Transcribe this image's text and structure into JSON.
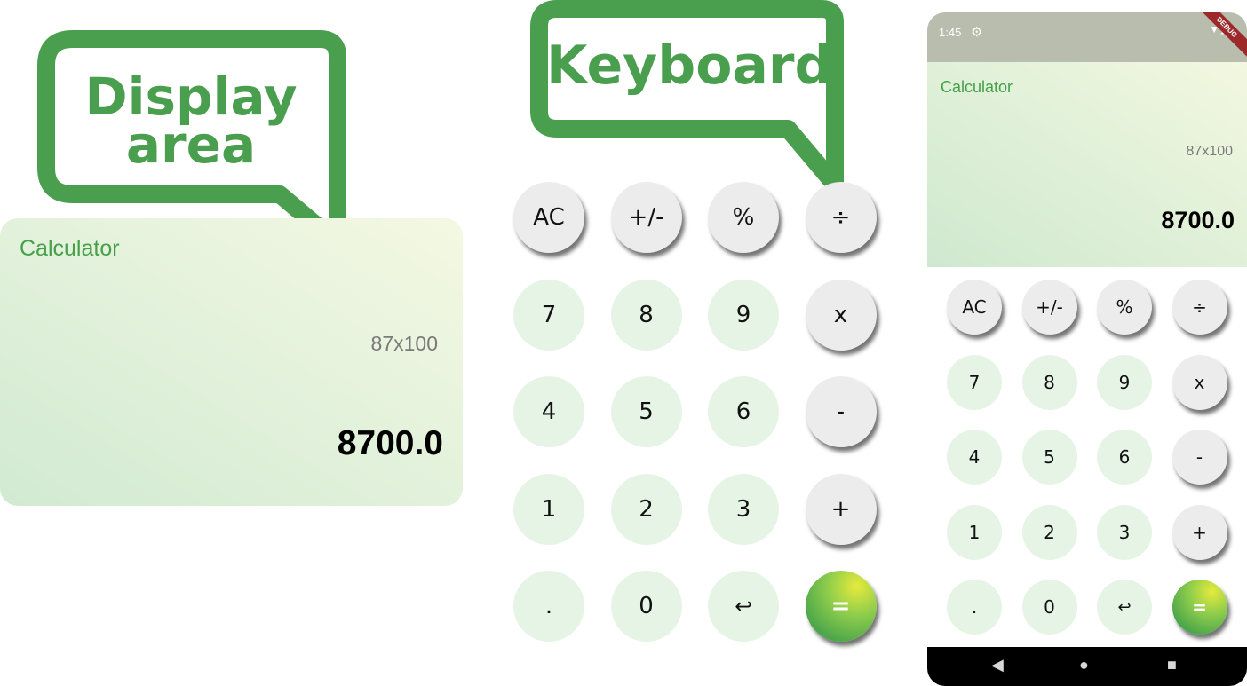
{
  "callouts": {
    "display": {
      "line1": "Display",
      "line2": "area"
    },
    "keyboard": {
      "text": "Keyboard"
    }
  },
  "display_panel": {
    "title": "Calculator",
    "expression": "87x100",
    "result": "8700.0"
  },
  "keyboard": {
    "keys": [
      {
        "label": "AC",
        "kind": "op"
      },
      {
        "label": "+/-",
        "kind": "op"
      },
      {
        "label": "%",
        "kind": "op"
      },
      {
        "label": "÷",
        "kind": "op"
      },
      {
        "label": "7",
        "kind": "digit"
      },
      {
        "label": "8",
        "kind": "digit"
      },
      {
        "label": "9",
        "kind": "digit"
      },
      {
        "label": "x",
        "kind": "op"
      },
      {
        "label": "4",
        "kind": "digit"
      },
      {
        "label": "5",
        "kind": "digit"
      },
      {
        "label": "6",
        "kind": "digit"
      },
      {
        "label": "-",
        "kind": "op"
      },
      {
        "label": "1",
        "kind": "digit"
      },
      {
        "label": "2",
        "kind": "digit"
      },
      {
        "label": "3",
        "kind": "digit"
      },
      {
        "label": "+",
        "kind": "op"
      },
      {
        "label": ".",
        "kind": "digit"
      },
      {
        "label": "0",
        "kind": "digit"
      },
      {
        "label": "↩",
        "kind": "digit"
      },
      {
        "label": "=",
        "kind": "eq"
      }
    ]
  },
  "phone": {
    "status_bar": {
      "time": "1:45",
      "settings_icon": "gear-icon",
      "system_icons": [
        "wifi-icon",
        "signal-icon",
        "battery-icon"
      ],
      "debug_banner": "DEBUG"
    },
    "display": {
      "title": "Calculator",
      "expression": "87x100",
      "result": "8700.0"
    },
    "nav": {
      "back_icon": "back-triangle-icon",
      "home_icon": "home-circle-icon",
      "recents_icon": "recents-square-icon"
    }
  },
  "colors": {
    "accent_green": "#4a9f4e",
    "digit_key_bg": "#e6f4e6",
    "op_key_bg": "#ececec",
    "equals_gradient": [
      "#e6ea3c",
      "#3f9e4a"
    ],
    "debug_ribbon": "#9c2a2a"
  }
}
